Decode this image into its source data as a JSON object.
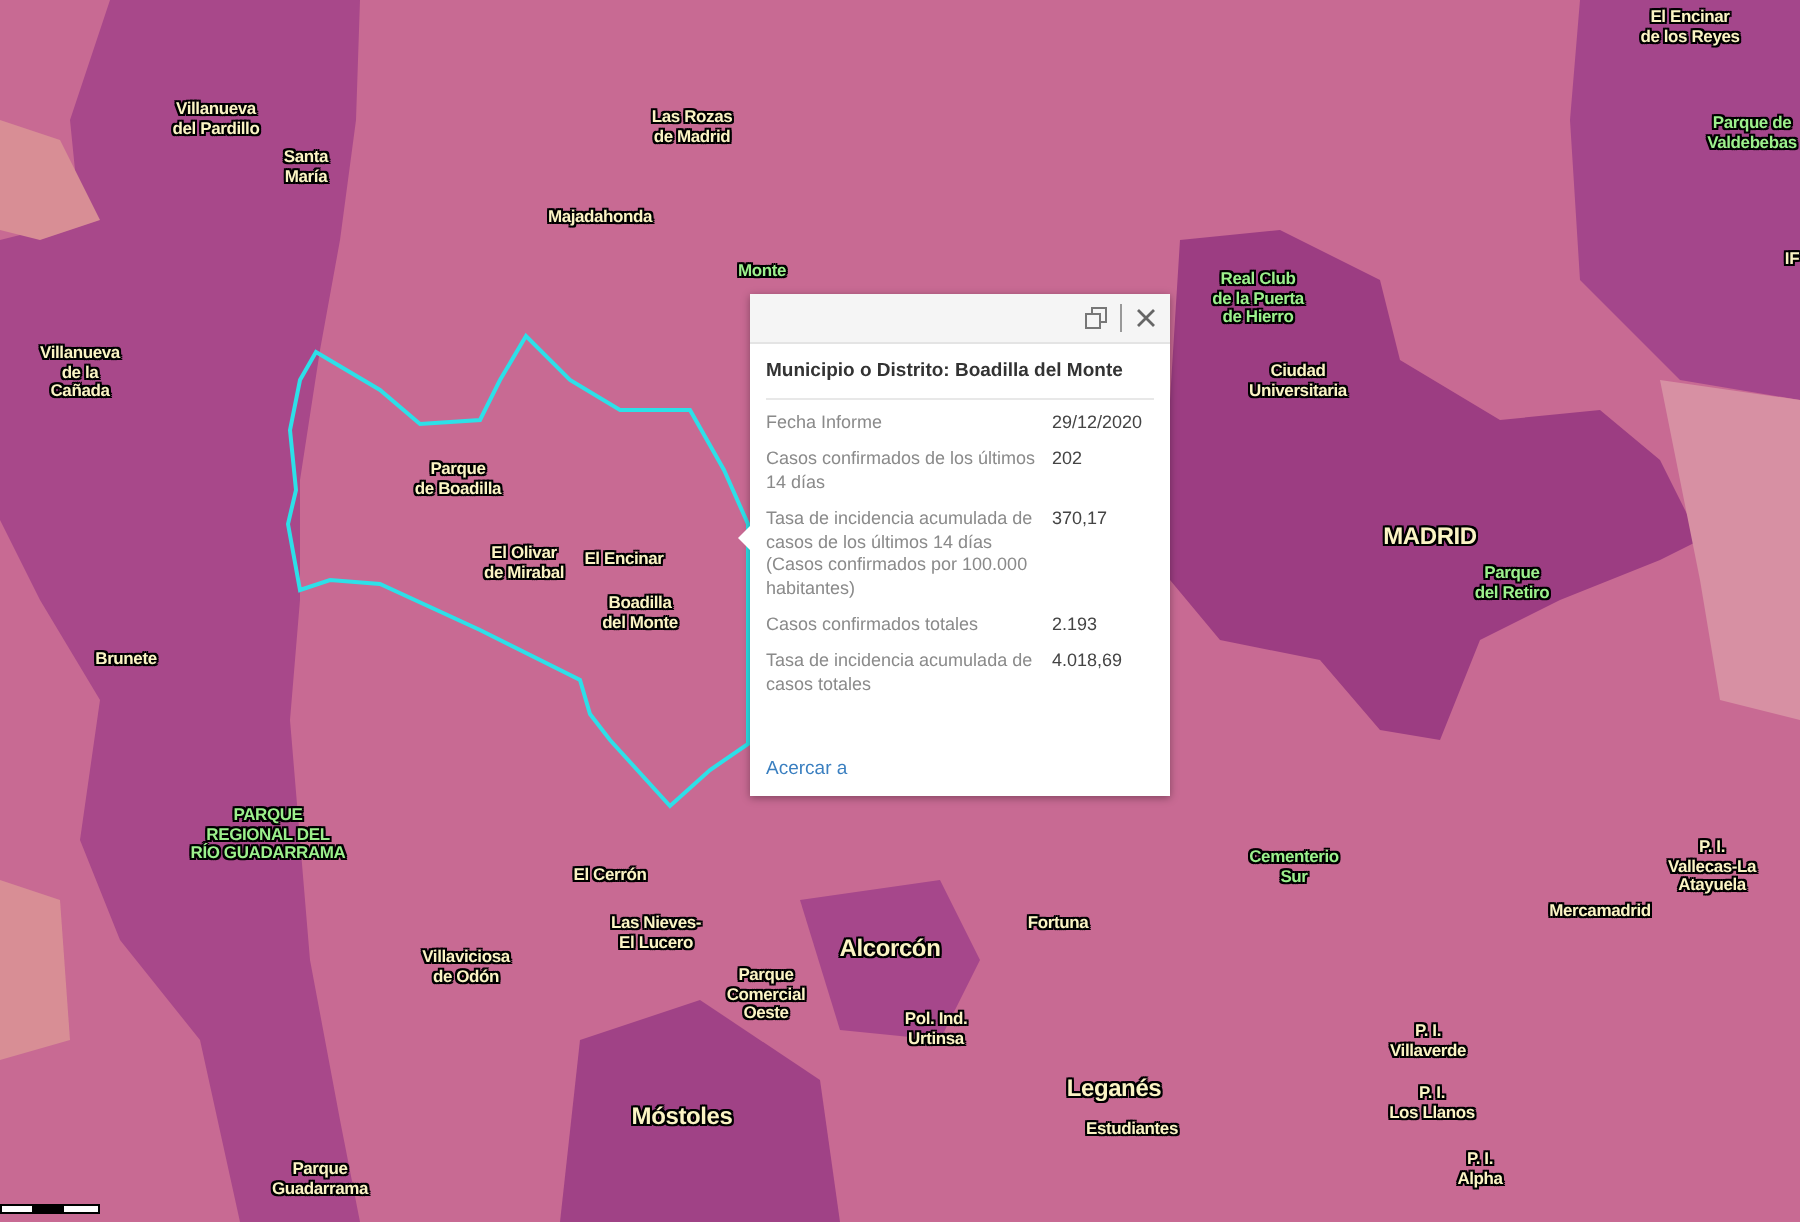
{
  "map": {
    "labels": [
      {
        "text": "El Encinar\nde los Reyes",
        "kind": "place"
      },
      {
        "text": "Villanueva\ndel Pardillo",
        "kind": "place"
      },
      {
        "text": "Santa\nMaría",
        "kind": "place"
      },
      {
        "text": "Las Rozas\nde Madrid",
        "kind": "place"
      },
      {
        "text": "Parque de\nValdebebas",
        "kind": "park"
      },
      {
        "text": "Majadahonda",
        "kind": "place"
      },
      {
        "text": "Monte",
        "kind": "park"
      },
      {
        "text": "Real Club\nde la Puerta\nde Hierro",
        "kind": "park"
      },
      {
        "text": "IF",
        "kind": "place"
      },
      {
        "text": "Villanueva\nde la\nCañada",
        "kind": "place"
      },
      {
        "text": "Ciudad\nUniversitaria",
        "kind": "place"
      },
      {
        "text": "Parque\nde Boadilla",
        "kind": "place"
      },
      {
        "text": "El Olivar\nde Mirabal",
        "kind": "place"
      },
      {
        "text": "El Encinar",
        "kind": "place"
      },
      {
        "text": "MADRID",
        "kind": "city"
      },
      {
        "text": "Boadilla\ndel Monte",
        "kind": "place"
      },
      {
        "text": "Parque\ndel Retiro",
        "kind": "park"
      },
      {
        "text": "Brunete",
        "kind": "place"
      },
      {
        "text": "PARQUE\nREGIONAL DEL\nRÍO GUADARRAMA",
        "kind": "park"
      },
      {
        "text": "El Cerrón",
        "kind": "place"
      },
      {
        "text": "Cementerio\nSur",
        "kind": "park"
      },
      {
        "text": "P. I.\nVallecas-La\nAtayuela",
        "kind": "place"
      },
      {
        "text": "Las Nieves-\nEl Lucero",
        "kind": "place"
      },
      {
        "text": "Fortuna",
        "kind": "place"
      },
      {
        "text": "Mercamadrid",
        "kind": "place"
      },
      {
        "text": "Villaviciosa\nde Odón",
        "kind": "place"
      },
      {
        "text": "Parque\nComercial\nOeste",
        "kind": "place"
      },
      {
        "text": "Alcorcón",
        "kind": "city"
      },
      {
        "text": "Pol. Ind.\nUrtinsa",
        "kind": "place"
      },
      {
        "text": "P. I.\nVillaverde",
        "kind": "place"
      },
      {
        "text": "Móstoles",
        "kind": "city"
      },
      {
        "text": "Leganés",
        "kind": "city"
      },
      {
        "text": "Estudiantes",
        "kind": "place"
      },
      {
        "text": "P. I.\nLos Llanos",
        "kind": "place"
      },
      {
        "text": "Parque\nGuadarrama",
        "kind": "place"
      },
      {
        "text": "P. I.\nAlpha",
        "kind": "place"
      }
    ]
  },
  "popup": {
    "title": "Municipio o Distrito: Boadilla del Monte",
    "fields": [
      {
        "label": "Fecha Informe",
        "value": "29/12/2020"
      },
      {
        "label": "Casos confirmados de los últimos 14 días",
        "value": "202"
      },
      {
        "label": "Tasa de incidencia acumulada de casos de los últimos 14 días (Casos confirmados por 100.000 habitantes)",
        "value": "370,17"
      },
      {
        "label": "Casos confirmados totales",
        "value": "2.193"
      },
      {
        "label": "Tasa de incidencia acumulada de casos totales",
        "value": "4.018,69"
      }
    ],
    "link": "Acercar a"
  }
}
